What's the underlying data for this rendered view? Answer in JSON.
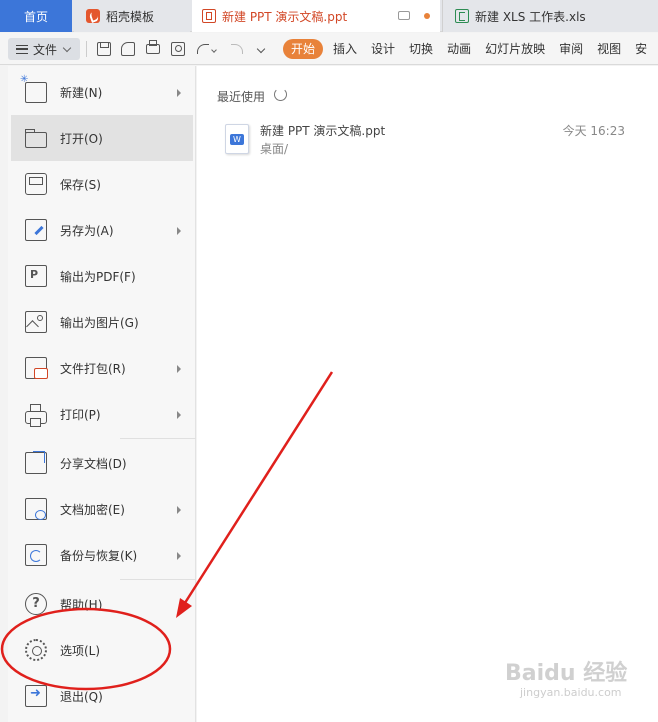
{
  "tabs": {
    "home": "首页",
    "templates": "稻壳模板",
    "ppt": "新建 PPT 演示文稿.ppt",
    "xls": "新建 XLS 工作表.xls"
  },
  "toolbar": {
    "file_label": "文件",
    "ribbon_tabs": [
      "开始",
      "插入",
      "设计",
      "切换",
      "动画",
      "幻灯片放映",
      "审阅",
      "视图",
      "安"
    ]
  },
  "file_menu": {
    "items": [
      {
        "label": "新建(N)",
        "icon": "new-file-icon",
        "has_submenu": true
      },
      {
        "label": "打开(O)",
        "icon": "folder-open-icon",
        "has_submenu": false
      },
      {
        "label": "保存(S)",
        "icon": "save-icon",
        "has_submenu": false
      },
      {
        "label": "另存为(A)",
        "icon": "save-as-icon",
        "has_submenu": true
      },
      {
        "label": "输出为PDF(F)",
        "icon": "pdf-icon",
        "has_submenu": false
      },
      {
        "label": "输出为图片(G)",
        "icon": "image-icon",
        "has_submenu": false
      },
      {
        "label": "文件打包(R)",
        "icon": "package-icon",
        "has_submenu": true
      },
      {
        "label": "打印(P)",
        "icon": "print-icon",
        "has_submenu": true
      },
      {
        "label": "分享文档(D)",
        "icon": "share-icon",
        "has_submenu": false
      },
      {
        "label": "文档加密(E)",
        "icon": "encrypt-icon",
        "has_submenu": true
      },
      {
        "label": "备份与恢复(K)",
        "icon": "backup-icon",
        "has_submenu": true
      },
      {
        "label": "帮助(H)",
        "icon": "help-icon",
        "has_submenu": false
      },
      {
        "label": "选项(L)",
        "icon": "gear-icon",
        "has_submenu": false
      },
      {
        "label": "退出(Q)",
        "icon": "exit-icon",
        "has_submenu": false
      }
    ]
  },
  "recent": {
    "title": "最近使用",
    "files": [
      {
        "name": "新建 PPT 演示文稿.ppt",
        "path": "桌面/",
        "time": "今天 16:23",
        "badge": "W"
      }
    ]
  },
  "watermark": {
    "text": "Baidu 经验",
    "sub": "jingyan.baidu.com"
  },
  "colors": {
    "accent": "#3c76d9",
    "active_ribbon": "#e8823a",
    "annotation": "#e0201c"
  }
}
